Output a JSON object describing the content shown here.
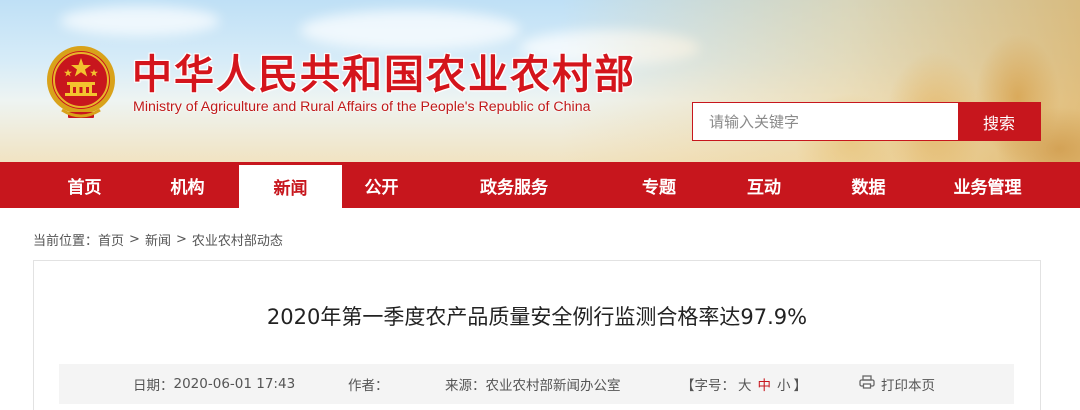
{
  "header": {
    "title_cn": "中华人民共和国农业农村部",
    "title_en": "Ministry of Agriculture and Rural Affairs of the People's Republic of China",
    "search": {
      "placeholder": "请输入关键字",
      "button_label": "搜索"
    }
  },
  "nav": {
    "items": [
      {
        "label": "首页"
      },
      {
        "label": "机构"
      },
      {
        "label": "新闻",
        "active": true
      },
      {
        "label": "公开"
      },
      {
        "label": "政务服务"
      },
      {
        "label": "专题"
      },
      {
        "label": "互动"
      },
      {
        "label": "数据"
      },
      {
        "label": "业务管理"
      }
    ]
  },
  "breadcrumb": {
    "prefix": "当前位置：",
    "items": [
      "首页",
      "新闻",
      "农业农村部动态"
    ],
    "separator": ">"
  },
  "article": {
    "title": "2020年第一季度农产品质量安全例行监测合格率达97.9%",
    "meta": {
      "date_label": "日期：",
      "date_value": "2020-06-01 17:43",
      "author_label": "作者：",
      "author_value": "",
      "source_label": "来源：",
      "source_value": "农业农村部新闻办公室",
      "fontsize_open": "【字号：",
      "fontsize_large": "大",
      "fontsize_medium": "中",
      "fontsize_small": "小",
      "fontsize_close": "】",
      "print_label": "打印本页"
    }
  },
  "colors": {
    "brand_red": "#c7161d",
    "meta_bg": "#f4f4f4"
  },
  "icons": {
    "emblem": "national-emblem-icon",
    "print": "printer-icon"
  }
}
